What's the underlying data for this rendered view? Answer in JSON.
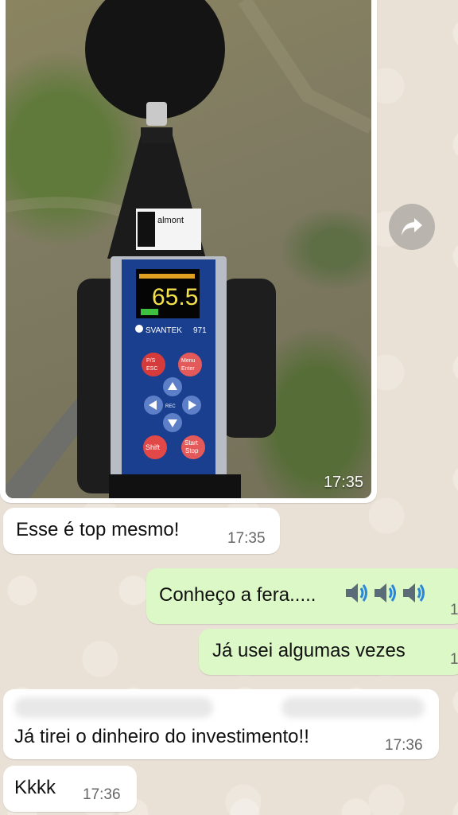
{
  "photo_message": {
    "time": "17:35",
    "meter": {
      "reading": "65.5",
      "brand": "SVANTEK",
      "model": "971",
      "logo": "almont",
      "btn_ps_esc_top": "P/S",
      "btn_ps_esc_bottom": "ESC",
      "btn_menu_top": "Menu",
      "btn_menu_bottom": "Enter",
      "btn_shift": "Shift",
      "btn_start": "Start",
      "btn_stop": "Stop",
      "rec_label": "REC"
    }
  },
  "messages": [
    {
      "id": "m1",
      "direction": "incoming",
      "text": "Esse é top mesmo!",
      "time": "17:35"
    },
    {
      "id": "m2",
      "direction": "outgoing",
      "text": "Conheço a fera.....",
      "emoji": [
        "speaker",
        "speaker",
        "speaker"
      ],
      "time": "1"
    },
    {
      "id": "m3",
      "direction": "outgoing",
      "text": "Já usei algumas vezes",
      "time": "1"
    },
    {
      "id": "m4",
      "direction": "incoming",
      "text": "Já tirei o dinheiro do investimento!!",
      "time": "17:36"
    },
    {
      "id": "m5",
      "direction": "incoming",
      "text": "Kkkk",
      "time": "17:36"
    }
  ],
  "colors": {
    "incoming_bubble": "#ffffff",
    "outgoing_bubble": "#dcf8c6",
    "chat_bg": "#ece5dd"
  }
}
